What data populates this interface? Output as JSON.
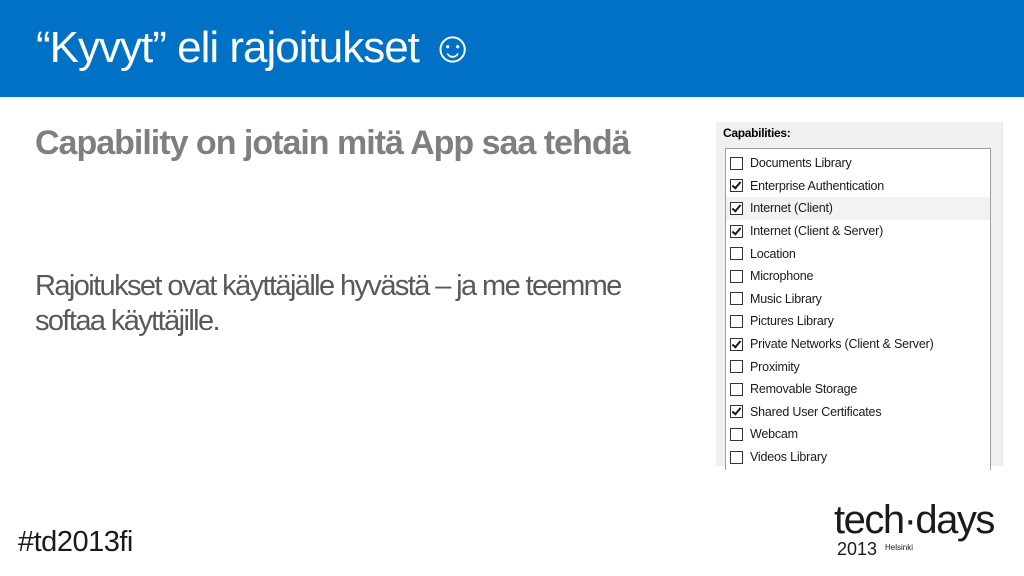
{
  "slide": {
    "title": "“Kyvyt” eli rajoitukset ☺",
    "subtitle": "Capability on jotain mitä App saa tehdä",
    "body": "Rajoitukset ovat käyttäjälle hyvästä – ja me teemme softaa käyttäjille.",
    "hashtag": "#td2013fi",
    "accent_color": "#0071c5"
  },
  "capabilities": {
    "heading": "Capabilities:",
    "items": [
      {
        "label": "Documents Library",
        "checked": false
      },
      {
        "label": "Enterprise Authentication",
        "checked": true
      },
      {
        "label": "Internet (Client)",
        "checked": true
      },
      {
        "label": "Internet (Client & Server)",
        "checked": true
      },
      {
        "label": "Location",
        "checked": false
      },
      {
        "label": "Microphone",
        "checked": false
      },
      {
        "label": "Music Library",
        "checked": false
      },
      {
        "label": "Pictures Library",
        "checked": false
      },
      {
        "label": "Private Networks (Client & Server)",
        "checked": true
      },
      {
        "label": "Proximity",
        "checked": false
      },
      {
        "label": "Removable Storage",
        "checked": false
      },
      {
        "label": "Shared User Certificates",
        "checked": true
      },
      {
        "label": "Webcam",
        "checked": false
      },
      {
        "label": "Videos Library",
        "checked": false
      }
    ]
  },
  "logo": {
    "main": "tech·days",
    "year": "2013",
    "city": "Helsinki"
  }
}
